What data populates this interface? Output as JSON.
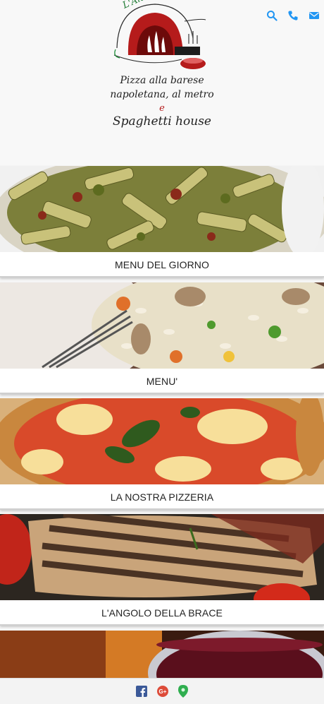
{
  "logo": {
    "brand": "L'Altra Bari Napoli",
    "tagline_line1": "Pizza alla barese",
    "tagline_line2": "napoletana, al metro",
    "tagline_line3": "e",
    "tagline_line4": "Spaghetti house"
  },
  "header_icons": [
    "search-icon",
    "phone-icon",
    "mail-icon"
  ],
  "accent_color": "#2196f3",
  "cards": [
    {
      "label": "MENU DEL GIORNO"
    },
    {
      "label": "MENU'"
    },
    {
      "label": "LA NOSTRA PIZZERIA"
    },
    {
      "label": "L'ANGOLO DELLA BRACE"
    }
  ],
  "footer_icons": [
    "facebook-icon",
    "google-plus-icon",
    "map-pin-icon"
  ],
  "footer_colors": {
    "facebook": "#3b5998",
    "google_plus": "#dd4b39",
    "map_pin": "#2fae4f"
  }
}
